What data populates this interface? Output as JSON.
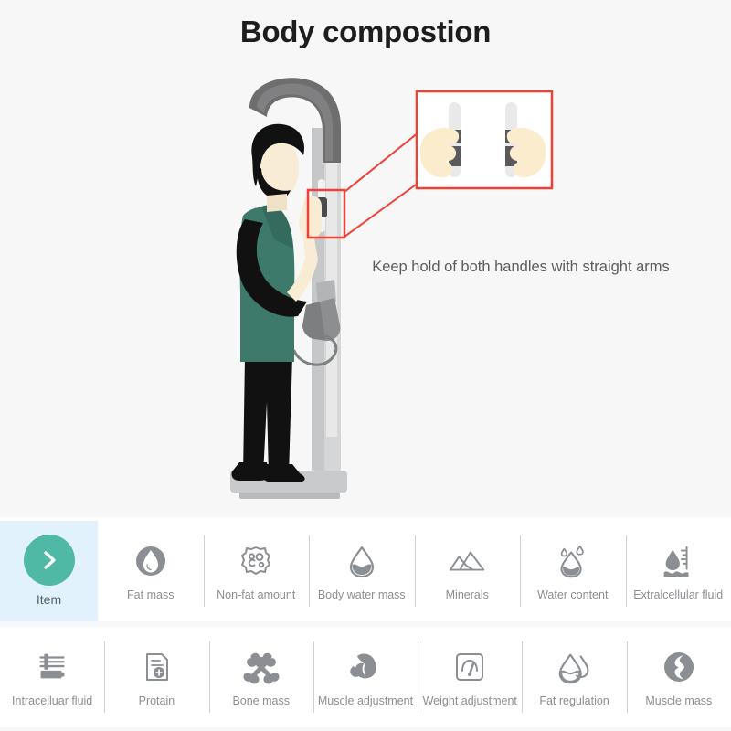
{
  "header": {
    "title": "Body compostion"
  },
  "illustration": {
    "instruction": "Keep hold of both handles with straight arms",
    "callout_color": "#ef4136",
    "shirt_color": "#3d7a6b",
    "machine_color": "#d9d9d9",
    "machine_dark_color": "#6e6e6e",
    "skin_color": "#f8ecd4",
    "hair_color": "#111111",
    "background_color": "#f7f7f7"
  },
  "toolbar": {
    "active_background": "#e2f2fc",
    "accent_color": "#4fb9a5",
    "icon_color": "#8b8f93",
    "rows": [
      {
        "items": [
          {
            "label": "Item",
            "icon": "chevron-right-icon",
            "active": true
          },
          {
            "label": "Fat mass",
            "icon": "fat-mass-droplet-icon",
            "active": false
          },
          {
            "label": "Non-fat amount",
            "icon": "non-fat-cell-icon",
            "active": false
          },
          {
            "label": "Body water mass",
            "icon": "body-water-droplet-icon",
            "active": false
          },
          {
            "label": "Minerals",
            "icon": "minerals-mountain-icon",
            "active": false
          },
          {
            "label": "Water content",
            "icon": "water-content-droplet-icon",
            "active": false
          },
          {
            "label": "Extralcellular fluid",
            "icon": "extracellular-fluid-icon",
            "active": false
          }
        ]
      },
      {
        "items": [
          {
            "label": "Intracelluar fluid",
            "icon": "intracellular-fluid-icon",
            "active": false
          },
          {
            "label": "Protain",
            "icon": "protein-document-icon",
            "active": false
          },
          {
            "label": "Bone mass",
            "icon": "bone-mass-icon",
            "active": false
          },
          {
            "label": "Muscle adjustment",
            "icon": "muscle-adjustment-icon",
            "active": false
          },
          {
            "label": "Weight adjustment",
            "icon": "weight-adjustment-gauge-icon",
            "active": false
          },
          {
            "label": "Fat regulation",
            "icon": "fat-regulation-droplet-icon",
            "active": false
          },
          {
            "label": "Muscle mass",
            "icon": "muscle-mass-circle-icon",
            "active": false
          }
        ]
      }
    ]
  }
}
